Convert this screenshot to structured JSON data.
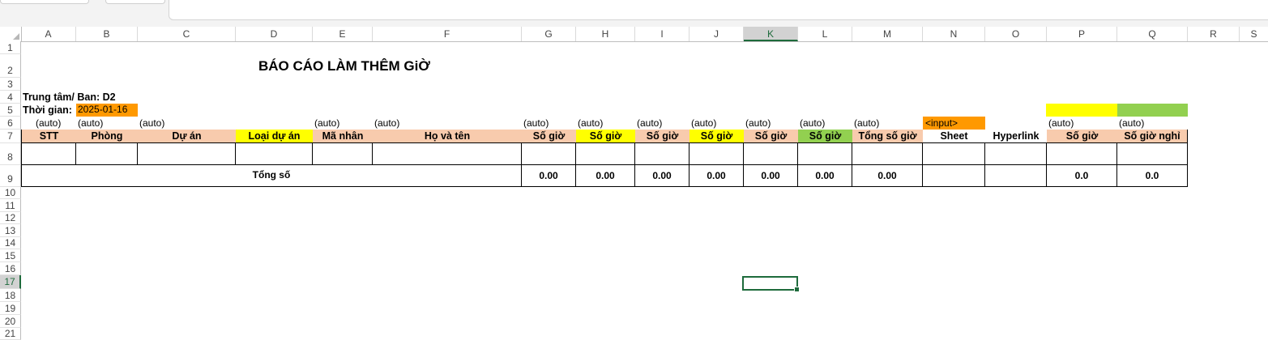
{
  "columns": [
    "A",
    "B",
    "C",
    "D",
    "E",
    "F",
    "G",
    "H",
    "I",
    "J",
    "K",
    "L",
    "M",
    "N",
    "O",
    "P",
    "Q",
    "R",
    "S"
  ],
  "selected_column": "K",
  "rows": [
    "1",
    "2",
    "3",
    "4",
    "5",
    "6",
    "7",
    "8",
    "9",
    "10",
    "11",
    "12",
    "13",
    "14",
    "15",
    "16",
    "17",
    "18",
    "19",
    "20",
    "21"
  ],
  "selected_row": "17",
  "report": {
    "title": "BÁO CÁO LÀM THÊM GiỜ",
    "center_label": "Trung tâm/ Ban: D2",
    "time_label": "Thời gian:",
    "time_value": "2025-01-16"
  },
  "auto_labels": {
    "A": "(auto)",
    "B": "(auto)",
    "C": "(auto)",
    "E": "(auto)",
    "F": "(auto)",
    "G": "(auto)",
    "H": "(auto)",
    "I": "(auto)",
    "J": "(auto)",
    "K": "(auto)",
    "L": "(auto)",
    "M": "(auto)",
    "N": "<input>",
    "P": "(auto)",
    "Q": "(auto)"
  },
  "headers": {
    "A": "STT",
    "B": "Phòng",
    "C": "Dự án",
    "D": "Loại dự án",
    "E": "Mã nhân",
    "F": "Họ và tên",
    "G": "Số giờ",
    "H": "Số giờ",
    "I": "Số giờ",
    "J": "Số giờ",
    "K": "Số giờ",
    "L": "Số giờ",
    "M": "Tổng số giờ",
    "N": "Sheet",
    "O": "Hyperlink",
    "P": "Số giờ",
    "Q": "Số giờ nghỉ"
  },
  "totals": {
    "label": "Tổng số",
    "G": "0.00",
    "H": "0.00",
    "I": "0.00",
    "J": "0.00",
    "K": "0.00",
    "L": "0.00",
    "M": "0.00",
    "P": "0.0",
    "Q": "0.0"
  },
  "colors": {
    "header_peach": "#f8cbad",
    "yellow": "#ffff00",
    "green": "#92d050",
    "orange": "#ff9900",
    "excel_green": "#1e6b3c"
  }
}
